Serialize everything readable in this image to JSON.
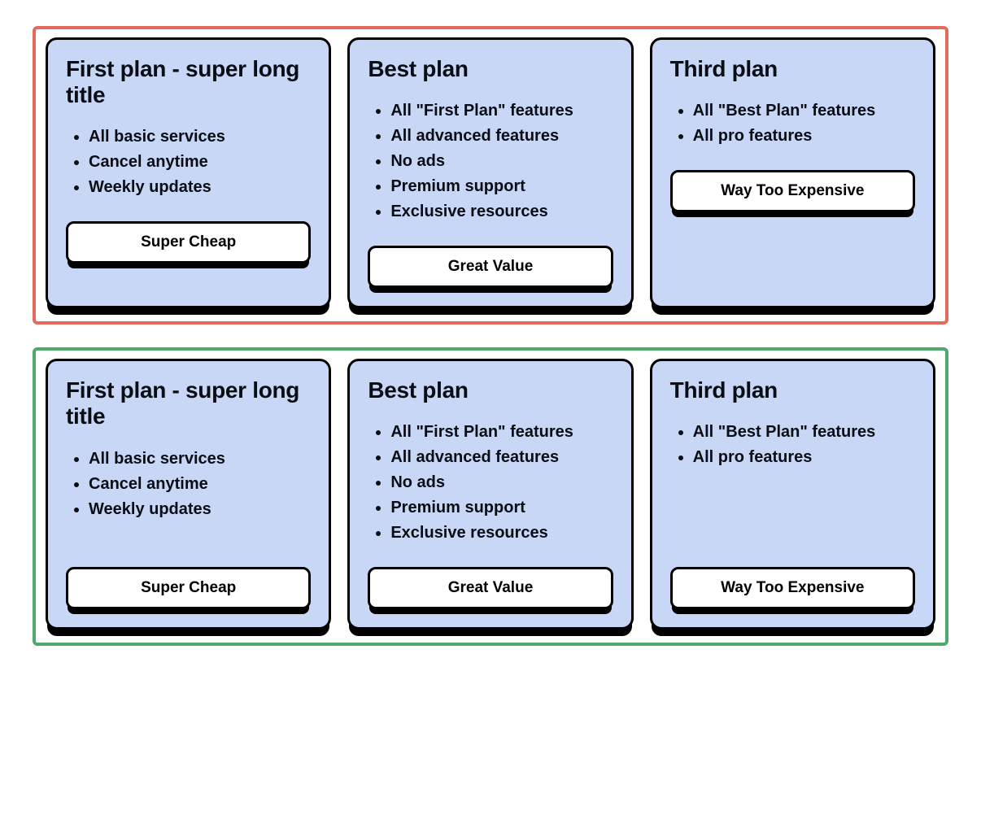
{
  "colors": {
    "card_bg": "#c9d7f7",
    "bad_border": "#e46a5e",
    "good_border": "#4fa86c",
    "text": "#0a0d14"
  },
  "plans": [
    {
      "title": "First plan - super long title",
      "features": [
        "All basic services",
        "Cancel anytime",
        "Weekly updates"
      ],
      "button": "Super Cheap"
    },
    {
      "title": "Best plan",
      "features": [
        "All \"First Plan\" features",
        "All advanced features",
        "No ads",
        "Premium support",
        "Exclusive resources"
      ],
      "button": "Great Value"
    },
    {
      "title": "Third plan",
      "features": [
        "All \"Best Plan\" features",
        "All pro features"
      ],
      "button": "Way Too Expensive"
    }
  ]
}
